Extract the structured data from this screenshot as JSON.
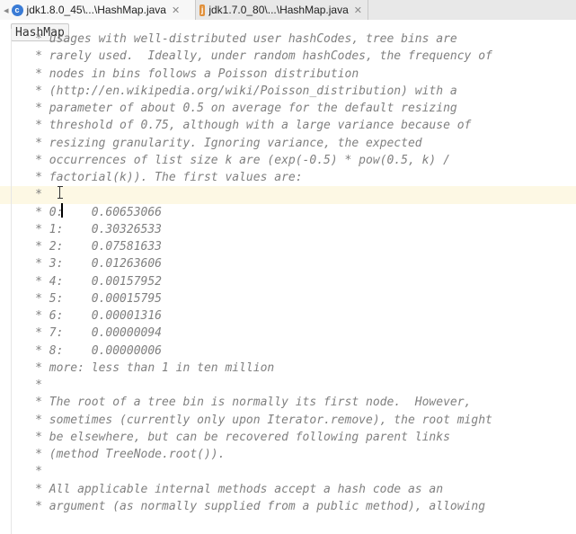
{
  "tabs": [
    {
      "label": "jdk1.8.0_45\\...\\HashMap.java",
      "active": true,
      "icon": "class-icon"
    },
    {
      "label": "jdk1.7.0_80\\...\\HashMap.java",
      "active": false,
      "icon": "java-file-icon"
    }
  ],
  "breadcrumb": {
    "class_name": "HashMap"
  },
  "code_lines": [
    "     * usages with well-distributed user hashCodes, tree bins are",
    "     * rarely used.  Ideally, under random hashCodes, the frequency of",
    "     * nodes in bins follows a Poisson distribution",
    "     * (http://en.wikipedia.org/wiki/Poisson_distribution) with a",
    "     * parameter of about 0.5 on average for the default resizing",
    "     * threshold of 0.75, although with a large variance because of",
    "     * resizing granularity. Ignoring variance, the expected",
    "     * occurrences of list size k are (exp(-0.5) * pow(0.5, k) /",
    "     * factorial(k)). The first values are:",
    "     *",
    "     * 0:    0.60653066",
    "     * 1:    0.30326533",
    "     * 2:    0.07581633",
    "     * 3:    0.01263606",
    "     * 4:    0.00157952",
    "     * 5:    0.00015795",
    "     * 6:    0.00001316",
    "     * 7:    0.00000094",
    "     * 8:    0.00000006",
    "     * more: less than 1 in ten million",
    "     *",
    "     * The root of a tree bin is normally its first node.  However,",
    "     * sometimes (currently only upon Iterator.remove), the root might",
    "     * be elsewhere, but can be recovered following parent links",
    "     * (method TreeNode.root()).",
    "     *",
    "     * All applicable internal methods accept a hash code as an",
    "     * argument (as normally supplied from a public method), allowing"
  ],
  "current_line_index": 9,
  "colors": {
    "comment": "#808080",
    "current_line": "#fdf8e4"
  }
}
